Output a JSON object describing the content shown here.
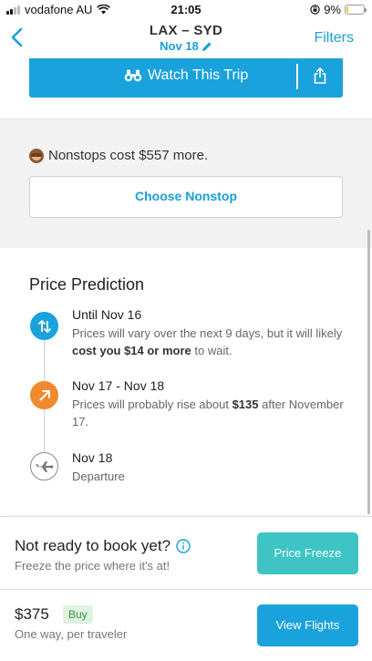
{
  "status_bar": {
    "carrier": "vodafone AU",
    "time": "21:05",
    "battery": "9%",
    "battery_level": 0.09,
    "signal_bars": 2,
    "icons": [
      "wifi-icon",
      "location-lock-icon",
      "battery-icon"
    ]
  },
  "nav": {
    "back_icon": "chevron-left-icon",
    "title": "LAX – SYD",
    "subtitle": "Nov 18",
    "edit_icon": "pencil-icon",
    "filters": "Filters"
  },
  "watch": {
    "label": "Watch This Trip",
    "icon": "binoculars-icon",
    "share_icon": "share-icon"
  },
  "nonstop": {
    "icon": "monkey-emoji-icon",
    "message": "Nonstops cost $557 more.",
    "button": "Choose Nonstop"
  },
  "prediction": {
    "title": "Price Prediction",
    "items": [
      {
        "icon": "arrows-up-down-icon",
        "title": "Until Nov 16",
        "desc_before": "Prices will vary over the next 9 days, but it will likely ",
        "desc_bold": "cost you $14 or more",
        "desc_after": " to wait."
      },
      {
        "icon": "arrow-up-right-icon",
        "title": "Nov 17 - Nov 18",
        "desc_before": "Prices will probably rise about ",
        "desc_bold": "$135",
        "desc_after": " after November 17."
      },
      {
        "icon": "airplane-icon",
        "title": "Nov 18",
        "desc_before": "Departure",
        "desc_bold": "",
        "desc_after": ""
      }
    ]
  },
  "freeze": {
    "question": "Not ready to book yet?",
    "info_icon": "info-icon",
    "subtitle": "Freeze the price where it's at!",
    "button": "Price Freeze"
  },
  "booking": {
    "price": "$375",
    "badge": "Buy",
    "subtitle": "One way, per traveler",
    "button": "View Flights"
  },
  "colors": {
    "accent_blue": "#1aa2dd",
    "teal": "#3ec4c4",
    "orange": "#ef8a2e",
    "buy_green": "#3a8f45"
  }
}
